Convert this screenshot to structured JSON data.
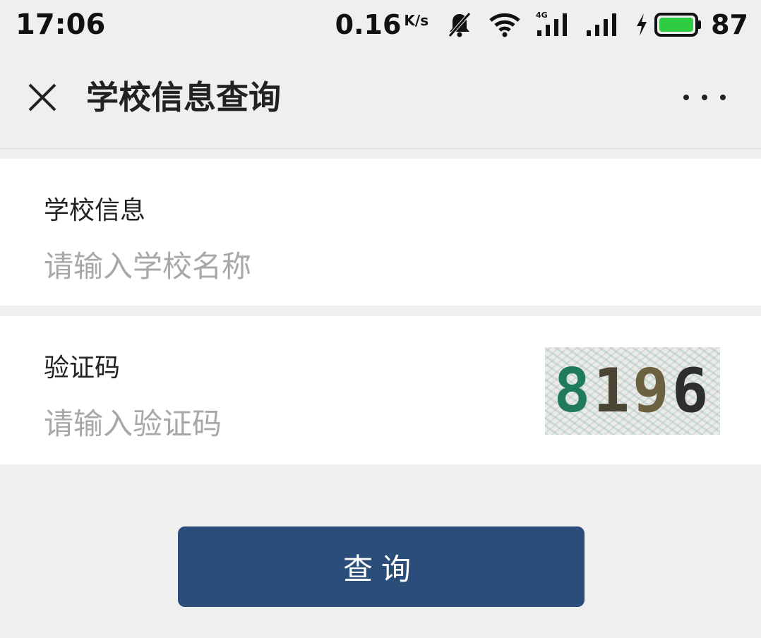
{
  "status_bar": {
    "time": "17:06",
    "net_speed": "0.16",
    "net_unit": "K/s",
    "network_type": "4G",
    "battery_percent": "87",
    "icons": [
      "mute-bell-icon",
      "wifi-icon",
      "signal-4g-icon",
      "signal-icon",
      "charging-icon",
      "battery-icon"
    ],
    "battery_color": "#2ecc40"
  },
  "nav": {
    "title": "学校信息查询",
    "close_icon": "close-icon",
    "more_icon": "more-icon"
  },
  "form": {
    "school": {
      "label": "学校信息",
      "value": "",
      "placeholder": "请输入学校名称"
    },
    "captcha": {
      "label": "验证码",
      "value": "",
      "placeholder": "请输入验证码",
      "image_code": [
        "8",
        "1",
        "9",
        "6"
      ]
    },
    "submit_label": "查询"
  },
  "colors": {
    "background": "#efefef",
    "card": "#ffffff",
    "primary_button": "#2b4d7a",
    "placeholder": "#a8a8a8"
  }
}
